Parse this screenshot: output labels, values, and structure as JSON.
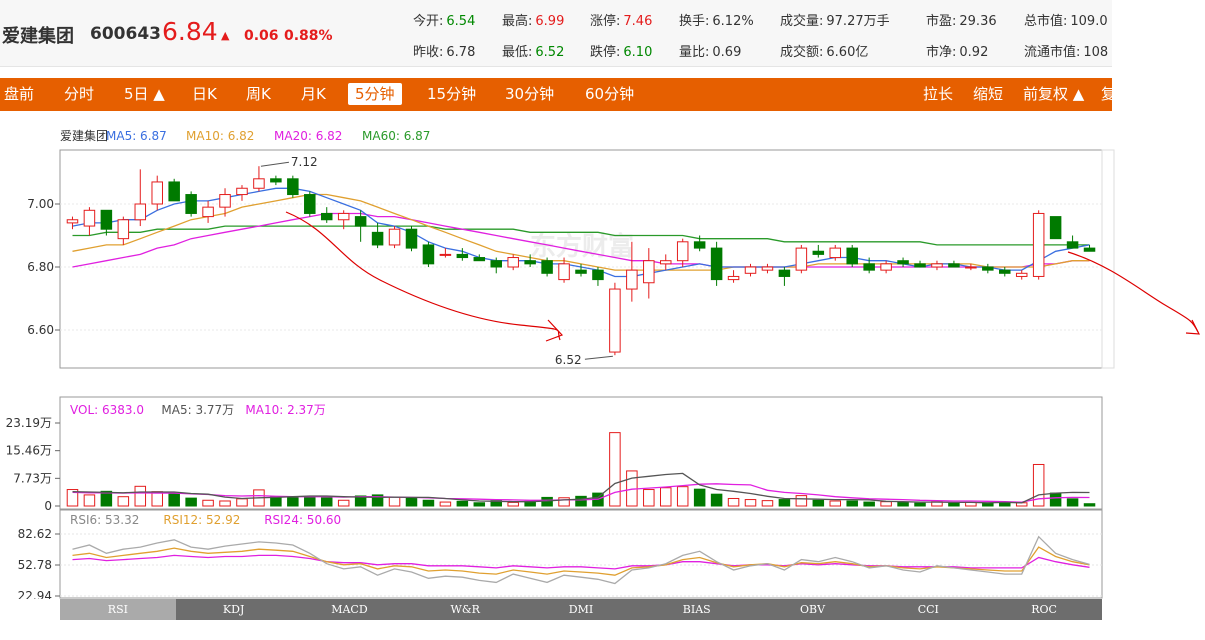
{
  "stock": {
    "name": "爱建集团",
    "code": "600643",
    "price": "6.84",
    "arrow": "▲",
    "change": "0.06",
    "change_pct": "0.88%"
  },
  "quote_items": [
    {
      "label": "今开:",
      "value": "6.54",
      "color": "green"
    },
    {
      "label": "最高:",
      "value": "6.99",
      "color": "red"
    },
    {
      "label": "涨停:",
      "value": "7.46",
      "color": "red"
    },
    {
      "label": "换手:",
      "value": "6.12%",
      "color": "dark"
    },
    {
      "label": "成交量:",
      "value": "97.27万手",
      "color": "dark"
    },
    {
      "label": "市盈:",
      "value": "29.36",
      "color": "dark"
    },
    {
      "label": "总市值:",
      "value": "109.0",
      "color": "dark"
    },
    {
      "label": "昨收:",
      "value": "6.78",
      "color": "dark"
    },
    {
      "label": "最低:",
      "value": "6.52",
      "color": "green"
    },
    {
      "label": "跌停:",
      "value": "6.10",
      "color": "green"
    },
    {
      "label": "量比:",
      "value": "0.69",
      "color": "dark"
    },
    {
      "label": "成交额:",
      "value": "6.60亿",
      "color": "dark"
    },
    {
      "label": "市净:",
      "value": "0.92",
      "color": "dark"
    },
    {
      "label": "流通市值:",
      "value": "108",
      "color": "dark"
    }
  ],
  "toolbar": {
    "items": [
      "盘前",
      "分时",
      "5日 ▲",
      "日K",
      "周K",
      "月K",
      "5分钟",
      "15分钟",
      "30分钟",
      "60分钟"
    ],
    "active": "5分钟",
    "right_items": [
      "拉长",
      "缩短",
      "前复权 ▲",
      "复"
    ]
  },
  "main_legend": [
    {
      "text": "爱建集团",
      "color": "#333333"
    },
    {
      "text": "MA5: 6.87",
      "color": "#3a6fe0"
    },
    {
      "text": "MA10: 6.82",
      "color": "#e0a030"
    },
    {
      "text": "MA20: 6.82",
      "color": "#e020e0"
    },
    {
      "text": "MA60: 6.87",
      "color": "#2a9a2a"
    }
  ],
  "price_axis": [
    "7.00",
    "6.80",
    "6.60"
  ],
  "annotations": {
    "high": "7.12",
    "low": "6.52"
  },
  "vol_legend": [
    {
      "text": "VOL: 6383.0",
      "color": "#e020e0"
    },
    {
      "text": "MA5: 3.77万",
      "color": "#555555"
    },
    {
      "text": "MA10: 2.37万",
      "color": "#e020e0"
    }
  ],
  "vol_axis": [
    "23.19万",
    "15.46万",
    "7.73万",
    "0"
  ],
  "rsi_legend": [
    {
      "text": "RSI6: 53.32",
      "color": "#888888"
    },
    {
      "text": "RSI12: 52.92",
      "color": "#e0a030"
    },
    {
      "text": "RSI24: 50.60",
      "color": "#e020e0"
    }
  ],
  "rsi_axis": [
    "82.62",
    "52.78",
    "22.94"
  ],
  "watermark": "东方财富",
  "indicator_tabs": [
    "RSI",
    "KDJ",
    "MACD",
    "W&R",
    "DMI",
    "BIAS",
    "OBV",
    "CCI",
    "ROC"
  ],
  "colors": {
    "up": "#e41c1c",
    "down": "#007a00",
    "toolbar": "#e65f00"
  },
  "chart_data": {
    "type": "candlestick",
    "interval": "5分钟",
    "candles": [
      {
        "o": 6.94,
        "h": 6.96,
        "l": 6.92,
        "c": 6.95
      },
      {
        "o": 6.93,
        "h": 6.99,
        "l": 6.9,
        "c": 6.98
      },
      {
        "o": 6.98,
        "h": 6.98,
        "l": 6.9,
        "c": 6.92
      },
      {
        "o": 6.89,
        "h": 6.96,
        "l": 6.87,
        "c": 6.95
      },
      {
        "o": 6.95,
        "h": 7.11,
        "l": 6.93,
        "c": 7.0
      },
      {
        "o": 7.0,
        "h": 7.09,
        "l": 6.98,
        "c": 7.07
      },
      {
        "o": 7.07,
        "h": 7.08,
        "l": 7.01,
        "c": 7.01
      },
      {
        "o": 7.03,
        "h": 7.04,
        "l": 6.96,
        "c": 6.97
      },
      {
        "o": 6.96,
        "h": 7.01,
        "l": 6.94,
        "c": 6.99
      },
      {
        "o": 6.99,
        "h": 7.05,
        "l": 6.96,
        "c": 7.03
      },
      {
        "o": 7.03,
        "h": 7.06,
        "l": 7.01,
        "c": 7.05
      },
      {
        "o": 7.05,
        "h": 7.12,
        "l": 7.04,
        "c": 7.08
      },
      {
        "o": 7.08,
        "h": 7.09,
        "l": 7.06,
        "c": 7.07
      },
      {
        "o": 7.08,
        "h": 7.09,
        "l": 7.02,
        "c": 7.03
      },
      {
        "o": 7.03,
        "h": 7.04,
        "l": 6.96,
        "c": 6.97
      },
      {
        "o": 6.97,
        "h": 6.99,
        "l": 6.94,
        "c": 6.95
      },
      {
        "o": 6.95,
        "h": 6.98,
        "l": 6.92,
        "c": 6.97
      },
      {
        "o": 6.96,
        "h": 6.98,
        "l": 6.88,
        "c": 6.93
      },
      {
        "o": 6.91,
        "h": 6.94,
        "l": 6.86,
        "c": 6.87
      },
      {
        "o": 6.87,
        "h": 6.93,
        "l": 6.86,
        "c": 6.92
      },
      {
        "o": 6.92,
        "h": 6.93,
        "l": 6.85,
        "c": 6.86
      },
      {
        "o": 6.87,
        "h": 6.88,
        "l": 6.8,
        "c": 6.81
      },
      {
        "o": 6.84,
        "h": 6.86,
        "l": 6.83,
        "c": 6.84
      },
      {
        "o": 6.84,
        "h": 6.86,
        "l": 6.82,
        "c": 6.83
      },
      {
        "o": 6.83,
        "h": 6.84,
        "l": 6.82,
        "c": 6.82
      },
      {
        "o": 6.82,
        "h": 6.83,
        "l": 6.78,
        "c": 6.8
      },
      {
        "o": 6.8,
        "h": 6.84,
        "l": 6.79,
        "c": 6.83
      },
      {
        "o": 6.82,
        "h": 6.84,
        "l": 6.8,
        "c": 6.81
      },
      {
        "o": 6.82,
        "h": 6.83,
        "l": 6.77,
        "c": 6.78
      },
      {
        "o": 6.76,
        "h": 6.83,
        "l": 6.75,
        "c": 6.81
      },
      {
        "o": 6.79,
        "h": 6.81,
        "l": 6.77,
        "c": 6.78
      },
      {
        "o": 6.79,
        "h": 6.8,
        "l": 6.74,
        "c": 6.76
      },
      {
        "o": 6.53,
        "h": 6.75,
        "l": 6.52,
        "c": 6.73
      },
      {
        "o": 6.73,
        "h": 6.88,
        "l": 6.69,
        "c": 6.79
      },
      {
        "o": 6.75,
        "h": 6.86,
        "l": 6.7,
        "c": 6.82
      },
      {
        "o": 6.81,
        "h": 6.84,
        "l": 6.79,
        "c": 6.82
      },
      {
        "o": 6.82,
        "h": 6.89,
        "l": 6.8,
        "c": 6.88
      },
      {
        "o": 6.88,
        "h": 6.9,
        "l": 6.85,
        "c": 6.86
      },
      {
        "o": 6.86,
        "h": 6.88,
        "l": 6.74,
        "c": 6.76
      },
      {
        "o": 6.76,
        "h": 6.79,
        "l": 6.75,
        "c": 6.77
      },
      {
        "o": 6.78,
        "h": 6.81,
        "l": 6.77,
        "c": 6.8
      },
      {
        "o": 6.79,
        "h": 6.81,
        "l": 6.78,
        "c": 6.8
      },
      {
        "o": 6.79,
        "h": 6.8,
        "l": 6.74,
        "c": 6.77
      },
      {
        "o": 6.79,
        "h": 6.87,
        "l": 6.78,
        "c": 6.86
      },
      {
        "o": 6.85,
        "h": 6.87,
        "l": 6.83,
        "c": 6.84
      },
      {
        "o": 6.83,
        "h": 6.87,
        "l": 6.82,
        "c": 6.86
      },
      {
        "o": 6.86,
        "h": 6.87,
        "l": 6.8,
        "c": 6.81
      },
      {
        "o": 6.81,
        "h": 6.83,
        "l": 6.78,
        "c": 6.79
      },
      {
        "o": 6.79,
        "h": 6.82,
        "l": 6.78,
        "c": 6.81
      },
      {
        "o": 6.82,
        "h": 6.83,
        "l": 6.8,
        "c": 6.81
      },
      {
        "o": 6.81,
        "h": 6.82,
        "l": 6.8,
        "c": 6.8
      },
      {
        "o": 6.8,
        "h": 6.82,
        "l": 6.79,
        "c": 6.81
      },
      {
        "o": 6.81,
        "h": 6.82,
        "l": 6.8,
        "c": 6.8
      },
      {
        "o": 6.8,
        "h": 6.81,
        "l": 6.79,
        "c": 6.8
      },
      {
        "o": 6.8,
        "h": 6.81,
        "l": 6.78,
        "c": 6.79
      },
      {
        "o": 6.79,
        "h": 6.8,
        "l": 6.77,
        "c": 6.78
      },
      {
        "o": 6.77,
        "h": 6.79,
        "l": 6.76,
        "c": 6.78
      },
      {
        "o": 6.77,
        "h": 6.98,
        "l": 6.76,
        "c": 6.97
      },
      {
        "o": 6.96,
        "h": 6.96,
        "l": 6.89,
        "c": 6.89
      },
      {
        "o": 6.88,
        "h": 6.9,
        "l": 6.86,
        "c": 6.86
      },
      {
        "o": 6.86,
        "h": 6.87,
        "l": 6.85,
        "c": 6.85
      }
    ],
    "ma5": [
      6.93,
      6.94,
      6.94,
      6.95,
      6.95,
      6.98,
      7.0,
      7.01,
      7.01,
      7.02,
      7.03,
      7.04,
      7.05,
      7.05,
      7.04,
      7.02,
      7.0,
      6.98,
      6.94,
      6.93,
      6.91,
      6.88,
      6.86,
      6.85,
      6.83,
      6.82,
      6.82,
      6.82,
      6.81,
      6.81,
      6.8,
      6.79,
      6.77,
      6.77,
      6.78,
      6.79,
      6.8,
      6.81,
      6.8,
      6.8,
      6.8,
      6.8,
      6.8,
      6.81,
      6.82,
      6.83,
      6.83,
      6.82,
      6.82,
      6.81,
      6.8,
      6.81,
      6.81,
      6.8,
      6.8,
      6.79,
      6.79,
      6.82,
      6.85,
      6.86,
      6.87
    ],
    "ma10": [
      6.85,
      6.86,
      6.87,
      6.87,
      6.89,
      6.91,
      6.93,
      6.95,
      6.96,
      6.97,
      6.99,
      7.0,
      7.01,
      7.02,
      7.03,
      7.03,
      7.02,
      7.01,
      6.99,
      6.97,
      6.95,
      6.93,
      6.91,
      6.89,
      6.87,
      6.85,
      6.84,
      6.83,
      6.82,
      6.82,
      6.81,
      6.8,
      6.79,
      6.79,
      6.79,
      6.79,
      6.79,
      6.79,
      6.79,
      6.8,
      6.8,
      6.8,
      6.8,
      6.8,
      6.81,
      6.81,
      6.81,
      6.81,
      6.81,
      6.81,
      6.81,
      6.81,
      6.81,
      6.81,
      6.8,
      6.8,
      6.8,
      6.8,
      6.81,
      6.82,
      6.82
    ],
    "ma20": [
      6.8,
      6.81,
      6.82,
      6.83,
      6.84,
      6.86,
      6.87,
      6.89,
      6.9,
      6.91,
      6.92,
      6.93,
      6.94,
      6.95,
      6.96,
      6.97,
      6.97,
      6.97,
      6.96,
      6.96,
      6.95,
      6.94,
      6.93,
      6.92,
      6.91,
      6.9,
      6.89,
      6.88,
      6.87,
      6.86,
      6.85,
      6.84,
      6.83,
      6.82,
      6.82,
      6.81,
      6.81,
      6.81,
      6.8,
      6.8,
      6.8,
      6.8,
      6.8,
      6.8,
      6.8,
      6.8,
      6.8,
      6.8,
      6.8,
      6.8,
      6.8,
      6.8,
      6.8,
      6.8,
      6.8,
      6.8,
      6.8,
      6.81,
      6.81,
      6.82,
      6.82
    ],
    "ma60": [
      6.9,
      6.9,
      6.91,
      6.91,
      6.91,
      6.92,
      6.92,
      6.92,
      6.92,
      6.93,
      6.93,
      6.93,
      6.93,
      6.93,
      6.93,
      6.93,
      6.93,
      6.93,
      6.93,
      6.93,
      6.93,
      6.93,
      6.92,
      6.92,
      6.92,
      6.92,
      6.92,
      6.91,
      6.91,
      6.91,
      6.91,
      6.91,
      6.9,
      6.9,
      6.9,
      6.9,
      6.9,
      6.89,
      6.89,
      6.89,
      6.89,
      6.89,
      6.88,
      6.88,
      6.88,
      6.88,
      6.88,
      6.88,
      6.88,
      6.88,
      6.88,
      6.87,
      6.87,
      6.87,
      6.87,
      6.87,
      6.87,
      6.87,
      6.87,
      6.87,
      6.87
    ],
    "volume": [
      4.6,
      3.1,
      4.1,
      2.6,
      5.5,
      4.0,
      3.4,
      2.2,
      1.6,
      1.4,
      2.0,
      4.5,
      2.5,
      2.4,
      2.4,
      2.3,
      1.6,
      2.8,
      3.1,
      2.5,
      2.1,
      1.6,
      1.1,
      1.3,
      0.9,
      1.5,
      1.0,
      1.3,
      2.4,
      2.3,
      2.7,
      3.6,
      20.5,
      9.8,
      4.6,
      5.1,
      5.4,
      4.7,
      3.3,
      2.1,
      1.8,
      1.5,
      1.8,
      2.9,
      1.6,
      1.4,
      1.4,
      1.1,
      1.2,
      1.0,
      0.8,
      1.2,
      0.8,
      1.0,
      0.8,
      1.0,
      0.9,
      11.6,
      3.6,
      2.0,
      0.64
    ],
    "vol_ma5": [
      4.0,
      3.9,
      3.8,
      3.7,
      3.9,
      3.9,
      3.9,
      3.5,
      3.3,
      2.5,
      2.1,
      2.3,
      2.4,
      2.6,
      2.8,
      2.8,
      2.6,
      2.5,
      2.4,
      2.5,
      2.4,
      2.4,
      2.1,
      1.7,
      1.4,
      1.3,
      1.2,
      1.2,
      1.4,
      1.7,
      1.9,
      2.4,
      6.3,
      7.8,
      8.3,
      8.8,
      9.1,
      5.9,
      4.6,
      4.1,
      3.5,
      2.7,
      2.1,
      2.0,
      1.9,
      1.8,
      1.8,
      1.7,
      1.3,
      1.2,
      1.1,
      1.1,
      1.0,
      1.0,
      0.9,
      1.0,
      0.9,
      3.1,
      3.6,
      3.8,
      3.77
    ],
    "vol_ma10": [
      3.8,
      3.7,
      3.7,
      3.6,
      3.7,
      3.6,
      3.6,
      3.4,
      3.2,
      2.9,
      2.8,
      2.9,
      2.7,
      2.6,
      2.6,
      2.6,
      2.5,
      2.6,
      2.6,
      2.5,
      2.4,
      2.3,
      2.1,
      2.0,
      1.9,
      1.8,
      1.7,
      1.6,
      1.6,
      1.7,
      1.7,
      1.9,
      3.8,
      4.7,
      5.0,
      5.3,
      5.7,
      6.1,
      6.2,
      6.0,
      5.9,
      4.4,
      3.8,
      3.5,
      3.1,
      2.6,
      2.3,
      2.0,
      1.9,
      1.8,
      1.6,
      1.5,
      1.4,
      1.4,
      1.3,
      1.2,
      1.1,
      2.0,
      2.3,
      2.4,
      2.37
    ],
    "rsi6": [
      68,
      72,
      64,
      68,
      70,
      74,
      77,
      70,
      68,
      71,
      73,
      75,
      74,
      72,
      64,
      54,
      49,
      51,
      43,
      49,
      46,
      40,
      42,
      41,
      38,
      36,
      44,
      40,
      36,
      43,
      41,
      39,
      35,
      48,
      50,
      54,
      62,
      66,
      56,
      48,
      52,
      54,
      48,
      58,
      56,
      60,
      56,
      50,
      52,
      48,
      46,
      52,
      50,
      48,
      46,
      44,
      44,
      80,
      64,
      58,
      53.32
    ],
    "rsi12": [
      62,
      64,
      60,
      62,
      64,
      66,
      69,
      66,
      64,
      65,
      66,
      68,
      67,
      66,
      61,
      56,
      53,
      54,
      49,
      52,
      51,
      47,
      48,
      47,
      45,
      44,
      48,
      46,
      44,
      47,
      46,
      45,
      43,
      50,
      51,
      53,
      58,
      60,
      55,
      51,
      53,
      54,
      51,
      55,
      54,
      56,
      54,
      51,
      52,
      50,
      49,
      51,
      50,
      49,
      48,
      47,
      47,
      70,
      61,
      56,
      52.92
    ],
    "rsi24": [
      58,
      59,
      57,
      58,
      59,
      60,
      62,
      61,
      60,
      61,
      61,
      62,
      62,
      61,
      59,
      56,
      55,
      55,
      53,
      54,
      54,
      52,
      52,
      52,
      51,
      50,
      52,
      51,
      50,
      51,
      51,
      50,
      49,
      52,
      52,
      53,
      56,
      56,
      54,
      52,
      53,
      53,
      52,
      54,
      53,
      54,
      53,
      52,
      52,
      51,
      51,
      51,
      51,
      50,
      50,
      50,
      50,
      60,
      56,
      53,
      50.6
    ]
  }
}
